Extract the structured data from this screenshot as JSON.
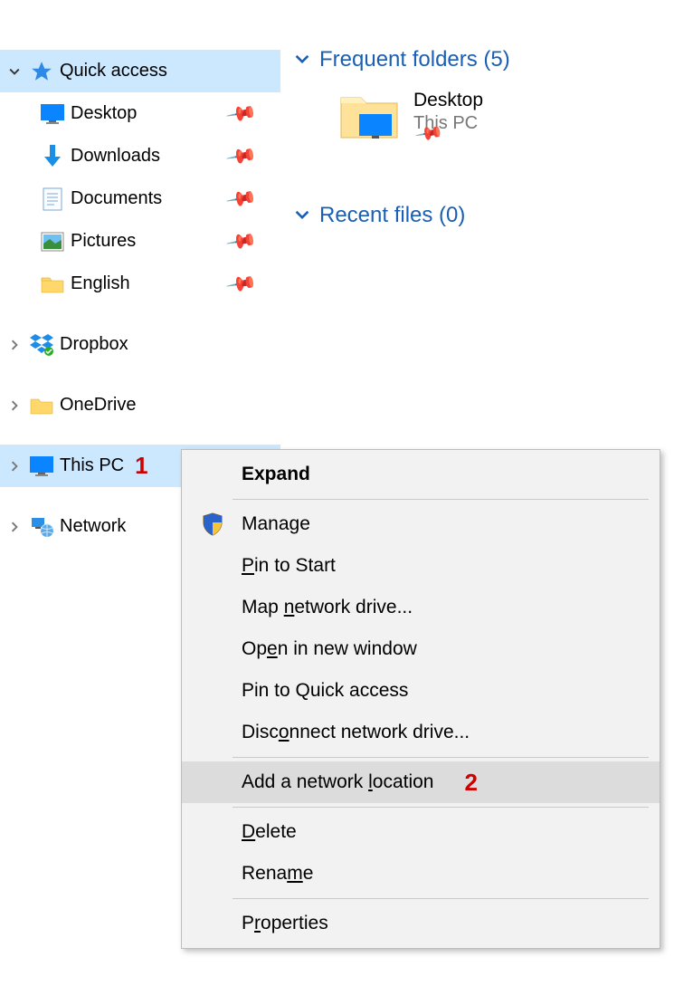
{
  "sidebar": {
    "quick_access": {
      "label": "Quick access",
      "items": [
        {
          "label": "Desktop",
          "pinned": true
        },
        {
          "label": "Downloads",
          "pinned": true
        },
        {
          "label": "Documents",
          "pinned": true
        },
        {
          "label": "Pictures",
          "pinned": true
        },
        {
          "label": "English",
          "pinned": true
        }
      ]
    },
    "dropbox": {
      "label": "Dropbox"
    },
    "onedrive": {
      "label": "OneDrive"
    },
    "this_pc": {
      "label": "This PC"
    },
    "network": {
      "label": "Network"
    }
  },
  "content": {
    "frequent_header": "Frequent folders (5)",
    "frequent_items": [
      {
        "name": "Desktop",
        "sub": "This PC",
        "pinned": true
      }
    ],
    "recent_header": "Recent files (0)"
  },
  "context_menu": {
    "items": [
      {
        "label": "Expand",
        "bold": true
      },
      {
        "sep": true
      },
      {
        "label": "Manage",
        "icon": "shield"
      },
      {
        "label": "Pin to Start",
        "u": 0
      },
      {
        "label": "Map network drive...",
        "u": 4
      },
      {
        "label": "Open in new window",
        "u": 2
      },
      {
        "label": "Pin to Quick access"
      },
      {
        "label": "Disconnect network drive...",
        "u": 4
      },
      {
        "sep": true
      },
      {
        "label": "Add a network location",
        "u": 14,
        "highlight": true
      },
      {
        "sep": true
      },
      {
        "label": "Delete",
        "u": 0
      },
      {
        "label": "Rename",
        "u": 4
      },
      {
        "sep": true
      },
      {
        "label": "Properties",
        "u": 1
      }
    ]
  },
  "annotations": {
    "one": "1",
    "two": "2"
  }
}
